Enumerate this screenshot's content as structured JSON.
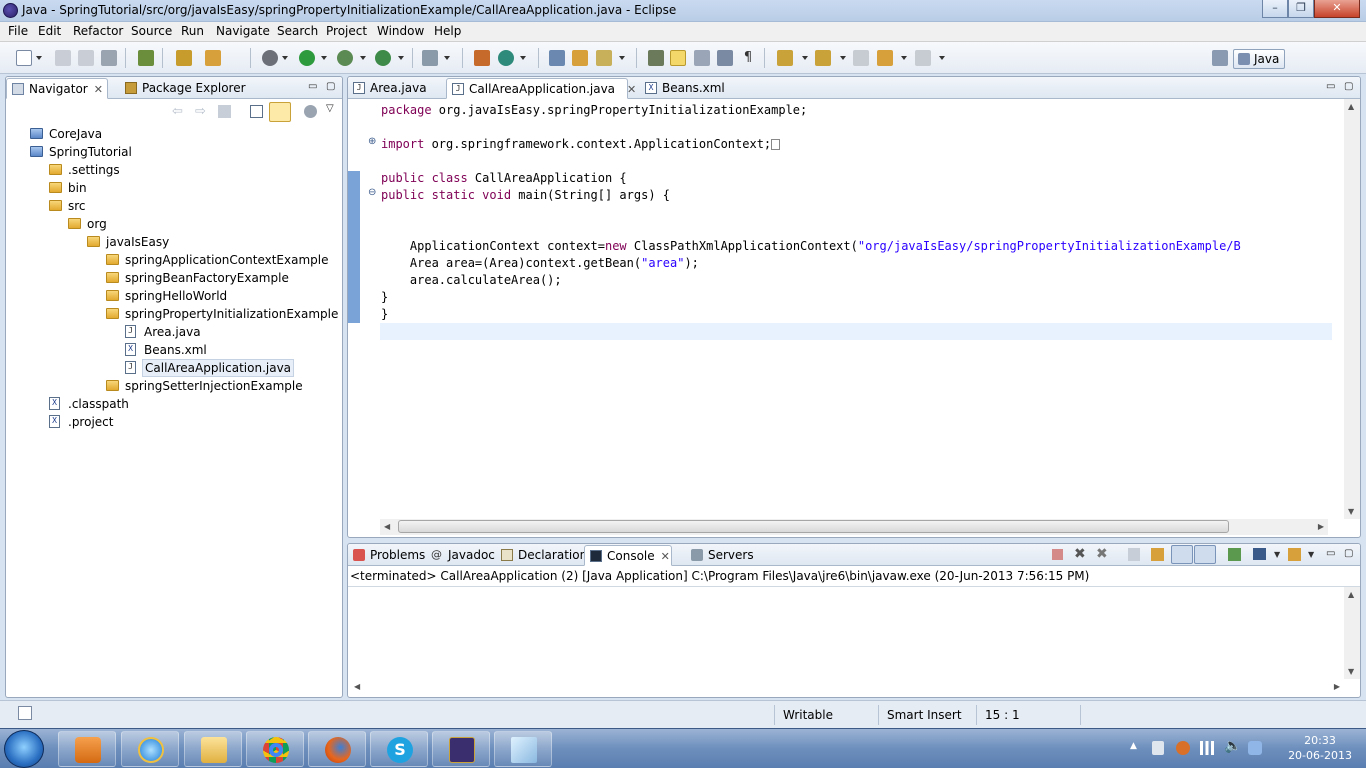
{
  "window": {
    "title": "Java - SpringTutorial/src/org/javaIsEasy/springPropertyInitializationExample/CallAreaApplication.java - Eclipse",
    "minimize_label": "–",
    "maximize_label": "❐",
    "close_label": "✕"
  },
  "menu": [
    "File",
    "Edit",
    "Refactor",
    "Source",
    "Run",
    "Navigate",
    "Search",
    "Project",
    "Window",
    "Help"
  ],
  "perspective": {
    "label": "Java"
  },
  "navigator": {
    "tabs": [
      {
        "label": "Navigator",
        "close": "✕"
      },
      {
        "label": "Package Explorer"
      }
    ],
    "tree": [
      {
        "label": "CoreJava",
        "icon": "project-icon"
      },
      {
        "label": "SpringTutorial",
        "icon": "project-icon"
      },
      {
        "label": ".settings",
        "icon": "folder-icon"
      },
      {
        "label": "bin",
        "icon": "folder-icon"
      },
      {
        "label": "src",
        "icon": "folder-icon"
      },
      {
        "label": "org",
        "icon": "folder-icon"
      },
      {
        "label": "javaIsEasy",
        "icon": "folder-icon"
      },
      {
        "label": "springApplicationContextExample",
        "icon": "folder-icon"
      },
      {
        "label": "springBeanFactoryExample",
        "icon": "folder-icon"
      },
      {
        "label": "springHelloWorld",
        "icon": "folder-icon"
      },
      {
        "label": "springPropertyInitializationExample",
        "icon": "folder-icon"
      },
      {
        "label": "Area.java",
        "icon": "java-file-icon"
      },
      {
        "label": "Beans.xml",
        "icon": "xml-file-icon"
      },
      {
        "label": "CallAreaApplication.java",
        "icon": "java-file-icon"
      },
      {
        "label": "springSetterInjectionExample",
        "icon": "folder-icon"
      },
      {
        "label": ".classpath",
        "icon": "xml-file-icon"
      },
      {
        "label": ".project",
        "icon": "xml-file-icon"
      }
    ]
  },
  "editor": {
    "tabs": [
      {
        "label": "Area.java"
      },
      {
        "label": "CallAreaApplication.java",
        "close": "✕"
      },
      {
        "label": "Beans.xml"
      }
    ],
    "code": {
      "l1_kw": "package",
      "l1_rest": " org.javaIsEasy.springPropertyInitializationExample;",
      "l3_kw": "import",
      "l3_rest": " org.springframework.context.ApplicationContext;",
      "l5_kw": "public class",
      "l5_rest": " CallAreaApplication {",
      "l6_kw": "public static void",
      "l6_rest": " main(String[] args) {",
      "l9_a": "    ApplicationContext context=",
      "l9_kw": "new",
      "l9_b": " ClassPathXmlApplicationContext(",
      "l9_str": "\"org/javaIsEasy/springPropertyInitializationExample/B",
      "l10_a": "    Area area=(Area)context.getBean(",
      "l10_str": "\"area\"",
      "l10_b": ");",
      "l11": "    area.calculateArea();",
      "l12": "}",
      "l13": "}"
    }
  },
  "bottom": {
    "tabs": [
      {
        "label": "Problems"
      },
      {
        "label": "Javadoc"
      },
      {
        "label": "Declaration"
      },
      {
        "label": "Console",
        "close": "✕"
      },
      {
        "label": "Servers"
      }
    ],
    "console_header": "<terminated> CallAreaApplication (2) [Java Application] C:\\Program Files\\Java\\jre6\\bin\\javaw.exe (20-Jun-2013 7:56:15 PM)"
  },
  "status": {
    "writable": "Writable",
    "insert_mode": "Smart Insert",
    "position": "15 : 1"
  },
  "taskbar": {
    "time": "20:33",
    "date": "20-06-2013",
    "apps": [
      "media-player-icon",
      "internet-explorer-icon",
      "file-explorer-icon",
      "chrome-icon",
      "firefox-icon",
      "skype-icon",
      "eclipse-javaee-icon",
      "notepad-icon"
    ]
  }
}
